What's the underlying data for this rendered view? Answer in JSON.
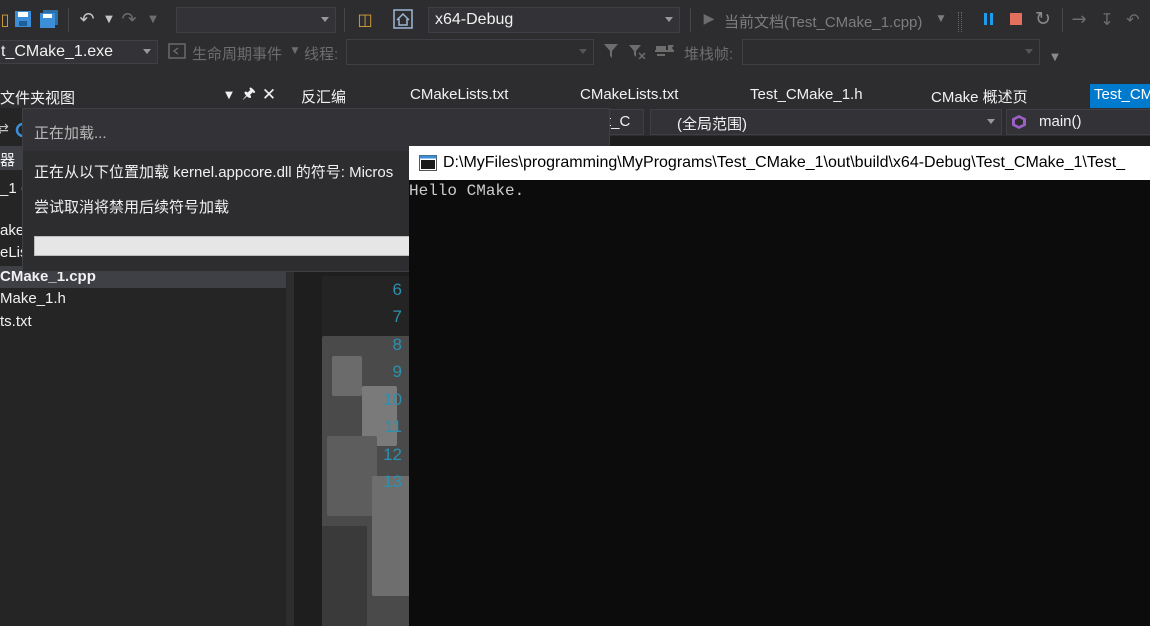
{
  "toolbar": {
    "config_value": "x64-Debug",
    "run_target_label": "当前文档(Test_CMake_1.cpp)",
    "run_target_icon": "play-icon",
    "pause_icon": "pause-icon",
    "stop_icon": "stop-icon",
    "restart_icon": "restart-icon",
    "accent_pause": "#1e9cf0",
    "accent_stop": "#e36f5e"
  },
  "debugbar": {
    "process_value": "t_CMake_1.exe",
    "lifecycle_label": "生命周期事件",
    "thread_label": "线程:",
    "stackframe_label": "堆栈帧:"
  },
  "solution_panel": {
    "title": "文件夹视图",
    "partial_row": "器",
    "items": [
      "_1 (",
      "ake",
      "eLis",
      "CMake_1.cpp",
      "Make_1.h",
      "ts.txt"
    ]
  },
  "tabs": [
    {
      "label": "反汇编",
      "active": false
    },
    {
      "label": "CMakeLists.txt",
      "active": false
    },
    {
      "label": "CMakeLists.txt",
      "active": false
    },
    {
      "label": "Test_CMake_1.h",
      "active": false
    },
    {
      "label": "CMake 概述页",
      "active": false
    },
    {
      "label": "Test_CM",
      "active": true
    }
  ],
  "navbar": {
    "file_combo": "t_C",
    "scope_combo": "(全局范围)",
    "member_combo": "main()"
  },
  "line_numbers": [
    "6",
    "7",
    "8",
    "9",
    "10",
    "11",
    "12",
    "13"
  ],
  "dialog": {
    "title": "正在加载...",
    "message": "正在从以下位置加载 kernel.appcore.dll 的符号: Micros",
    "cancel_link": "尝试取消将禁用后续符号加载",
    "progress": 0.0
  },
  "console": {
    "title": "D:\\MyFiles\\programming\\MyPrograms\\Test_CMake_1\\out\\build\\x64-Debug\\Test_CMake_1\\Test_",
    "output": "Hello CMake."
  }
}
